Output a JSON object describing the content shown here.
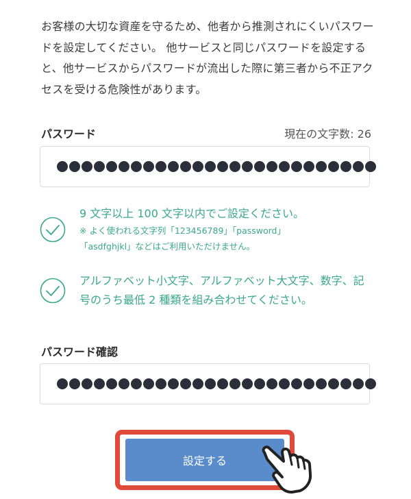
{
  "intro_text": "お客様の大切な資産を守るため、他者から推測されにくいパスワードを設定してください。 他サービスと同じパスワードを設定すると、他サービスからパスワードが流出した際に第三者から不正アクセスを受ける危険性があります。",
  "password": {
    "label": "パスワード",
    "char_count_label": "現在の文字数: 26",
    "masked_length": 26
  },
  "rules": [
    {
      "text": "9 文字以上 100 文字以内でご設定ください。",
      "note_line1": "※ よく使われる文字列「123456789」「password」",
      "note_line2": "「asdfghjkl」などはご利用いただけません。",
      "status": "satisfied"
    },
    {
      "text_line1": "アルファベット小文字、アルファベット大文字、数字、記",
      "text_line2": "号のうち最低 2 種類を組み合わせてください。",
      "status": "satisfied"
    }
  ],
  "password_confirm": {
    "label": "パスワード確認",
    "masked_length": 26
  },
  "submit": {
    "label": "設定する"
  },
  "colors": {
    "accent_green": "#3aa889",
    "button_blue": "#5a8ccb",
    "highlight_red": "#e04a3a",
    "dot_dark": "#2a2f3a"
  },
  "icons": [
    "check-circle-icon",
    "pointing-hand-cursor-icon"
  ]
}
